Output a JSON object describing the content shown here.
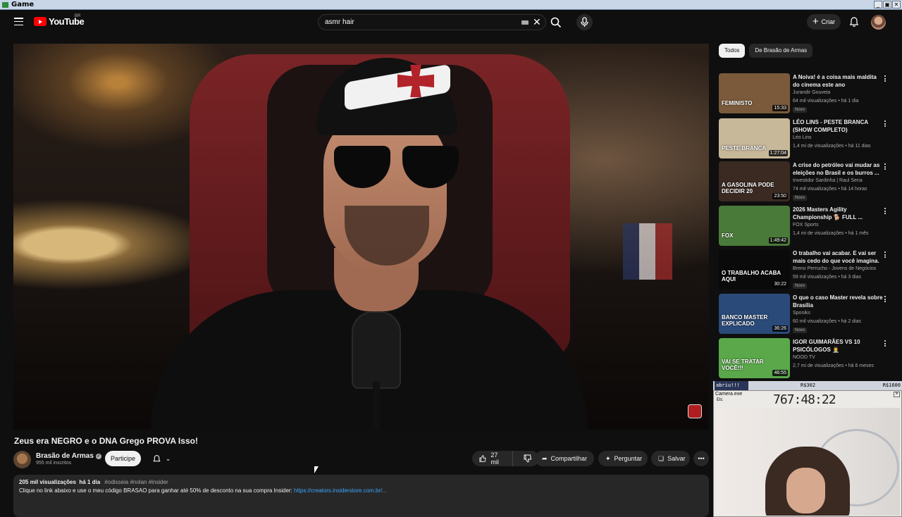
{
  "window": {
    "title": "Game",
    "btn_min": "_",
    "btn_max": "▣",
    "btn_close": "✕"
  },
  "header": {
    "logo_text": "YouTube",
    "region": "BR",
    "search_query": "asmr hair",
    "create_label": "Criar"
  },
  "video": {
    "title": "Zeus era NEGRO e o DNA Grego PROVA Isso!",
    "channel": "Brasão de Armas",
    "subscribers": "955 mil inscritos",
    "join_label": "Participe",
    "likes": "27 mil",
    "share_label": "Compartilhar",
    "ask_label": "Perguntar",
    "save_label": "Salvar",
    "views": "205 mil visualizações",
    "age": "há 1 dia",
    "tags": "#odisseia #nolan #insider",
    "description": "Clique no link abaixo e use o meu código BRASAO para ganhar até 50% de desconto na sua compra Insider: ",
    "description_link": "https://creators.insiderstore.com.br/..."
  },
  "sidebar": {
    "chips": [
      "Todos",
      "De Brasão de Armas"
    ],
    "items": [
      {
        "title": "A Noiva! é a coisa mais maldita do cinema este ano",
        "channel": "Jurandir Gouveia",
        "meta": "64 mil visualizações • há 1 dia",
        "badge": "Novo",
        "duration": "15:33",
        "thumb_text": "FEMINISTO",
        "thumb": "#7a5a3a"
      },
      {
        "title": "LÉO LINS - PESTE BRANCA (SHOW COMPLETO)",
        "channel": "Léo Lins",
        "meta": "1,4 mi de visualizações • há 11 dias",
        "badge": "",
        "duration": "1:27:04",
        "thumb_text": "PESTE BRANCA",
        "thumb": "#c8b89a"
      },
      {
        "title": "A crise do petróleo vai mudar as eleições no Brasil e os burros ...",
        "channel": "Investidor Sardinha | Raul Sena",
        "meta": "74 mil visualizações • há 14 horas",
        "badge": "Novo",
        "duration": "23:50",
        "thumb_text": "A GASOLINA PODE DECIDIR 20",
        "thumb": "#3a2a22"
      },
      {
        "title": "2026 Masters Agility Championship 🐕 FULL ...",
        "channel": "FOX Sports",
        "meta": "1,4 mi de visualizações • há 1 mês",
        "badge": "",
        "duration": "1:49:42",
        "thumb_text": "FOX",
        "thumb": "#4a7a3a"
      },
      {
        "title": "O trabalho vai acabar. E vai ser mais cedo do que você imagina.",
        "channel": "Breno Perrucho - Jovens de Negócios",
        "meta": "59 mil visualizações • há 3 dias",
        "badge": "Novo",
        "duration": "30:22",
        "thumb_text": "O TRABALHO ACABA AQUI",
        "thumb": "#0a0a0a"
      },
      {
        "title": "O que o caso Master revela sobre Brasília",
        "channel": "Sponiks",
        "meta": "60 mil visualizações • há 2 dias",
        "badge": "Novo",
        "duration": "36:26",
        "thumb_text": "BANCO MASTER EXPLICADO",
        "thumb": "#2a4a7a"
      },
      {
        "title": "IGOR GUIMARÃES VS 10 PSICÓLOGOS 👨‍⚕️",
        "channel": "NOOD TV",
        "meta": "2,7 mi de visualizações • há 6 meses",
        "badge": "",
        "duration": "46:55",
        "thumb_text": "VAI SE TRATAR VOCÊ!!!",
        "thumb": "#5aa84a"
      }
    ]
  },
  "overlay": {
    "bar_label": "abriu!!!",
    "bar_price1": "R$302",
    "bar_price2": "R$1600",
    "cam_caption": "Camera.exe",
    "cam_sub": "Etc",
    "timer": "767:48:22"
  },
  "colors": {
    "accent": "#ff0000",
    "link": "#3ea6ff",
    "bg": "#0f0f0f"
  }
}
